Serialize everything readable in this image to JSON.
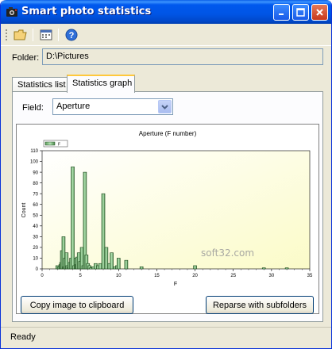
{
  "window": {
    "title": "Smart photo statistics"
  },
  "toolbar": {
    "items": [
      "open-folder-icon",
      "calendar-icon",
      "help-icon"
    ]
  },
  "folder": {
    "label": "Folder:",
    "value": "D:\\Pictures"
  },
  "tabs": [
    {
      "label": "Statistics list",
      "active": false
    },
    {
      "label": "Statistics graph",
      "active": true
    }
  ],
  "field": {
    "label": "Field:",
    "selected": "Aperture"
  },
  "chart_data": {
    "type": "bar",
    "title": "Aperture (F number)",
    "xlabel": "F",
    "ylabel": "Count",
    "legend": [
      "F"
    ],
    "legend_position": "top-left",
    "xlim": [
      0,
      35
    ],
    "ylim": [
      0,
      110
    ],
    "xticks": [
      0,
      5,
      10,
      15,
      20,
      25,
      30,
      35
    ],
    "yticks": [
      0,
      10,
      20,
      30,
      40,
      50,
      60,
      70,
      80,
      90,
      100,
      110
    ],
    "grid": false,
    "watermark": "soft32.com",
    "points": [
      {
        "x": 2.0,
        "y": 3
      },
      {
        "x": 2.2,
        "y": 2
      },
      {
        "x": 2.4,
        "y": 4
      },
      {
        "x": 2.5,
        "y": 6
      },
      {
        "x": 2.6,
        "y": 17
      },
      {
        "x": 2.8,
        "y": 30
      },
      {
        "x": 2.9,
        "y": 2
      },
      {
        "x": 3.0,
        "y": 10
      },
      {
        "x": 3.2,
        "y": 15
      },
      {
        "x": 3.3,
        "y": 3
      },
      {
        "x": 3.5,
        "y": 2
      },
      {
        "x": 3.6,
        "y": 6
      },
      {
        "x": 3.8,
        "y": 10
      },
      {
        "x": 4.0,
        "y": 95
      },
      {
        "x": 4.2,
        "y": 3
      },
      {
        "x": 4.4,
        "y": 10
      },
      {
        "x": 4.5,
        "y": 4
      },
      {
        "x": 4.6,
        "y": 11
      },
      {
        "x": 4.8,
        "y": 15
      },
      {
        "x": 5.0,
        "y": 7
      },
      {
        "x": 5.2,
        "y": 20
      },
      {
        "x": 5.4,
        "y": 3
      },
      {
        "x": 5.6,
        "y": 90
      },
      {
        "x": 5.8,
        "y": 13
      },
      {
        "x": 6.0,
        "y": 5
      },
      {
        "x": 6.2,
        "y": 3
      },
      {
        "x": 6.4,
        "y": 1
      },
      {
        "x": 6.7,
        "y": 2
      },
      {
        "x": 7.0,
        "y": 5
      },
      {
        "x": 7.3,
        "y": 3
      },
      {
        "x": 7.6,
        "y": 5
      },
      {
        "x": 8.0,
        "y": 70
      },
      {
        "x": 8.4,
        "y": 20
      },
      {
        "x": 8.8,
        "y": 5
      },
      {
        "x": 9.1,
        "y": 15
      },
      {
        "x": 9.5,
        "y": 2
      },
      {
        "x": 9.8,
        "y": 3
      },
      {
        "x": 10.0,
        "y": 10
      },
      {
        "x": 11.0,
        "y": 8
      },
      {
        "x": 13.0,
        "y": 2
      },
      {
        "x": 20.0,
        "y": 3
      },
      {
        "x": 29.0,
        "y": 1
      },
      {
        "x": 32.0,
        "y": 1
      }
    ]
  },
  "buttons": {
    "copy": "Copy image to clipboard",
    "reparse": "Reparse with subfolders"
  },
  "status": {
    "text": "Ready"
  },
  "colors": {
    "bar_fill": "#8fc88f",
    "bar_stroke": "#1f4a1f",
    "plot_bg": "#fdfde0",
    "title_bar": "#0055e5"
  }
}
